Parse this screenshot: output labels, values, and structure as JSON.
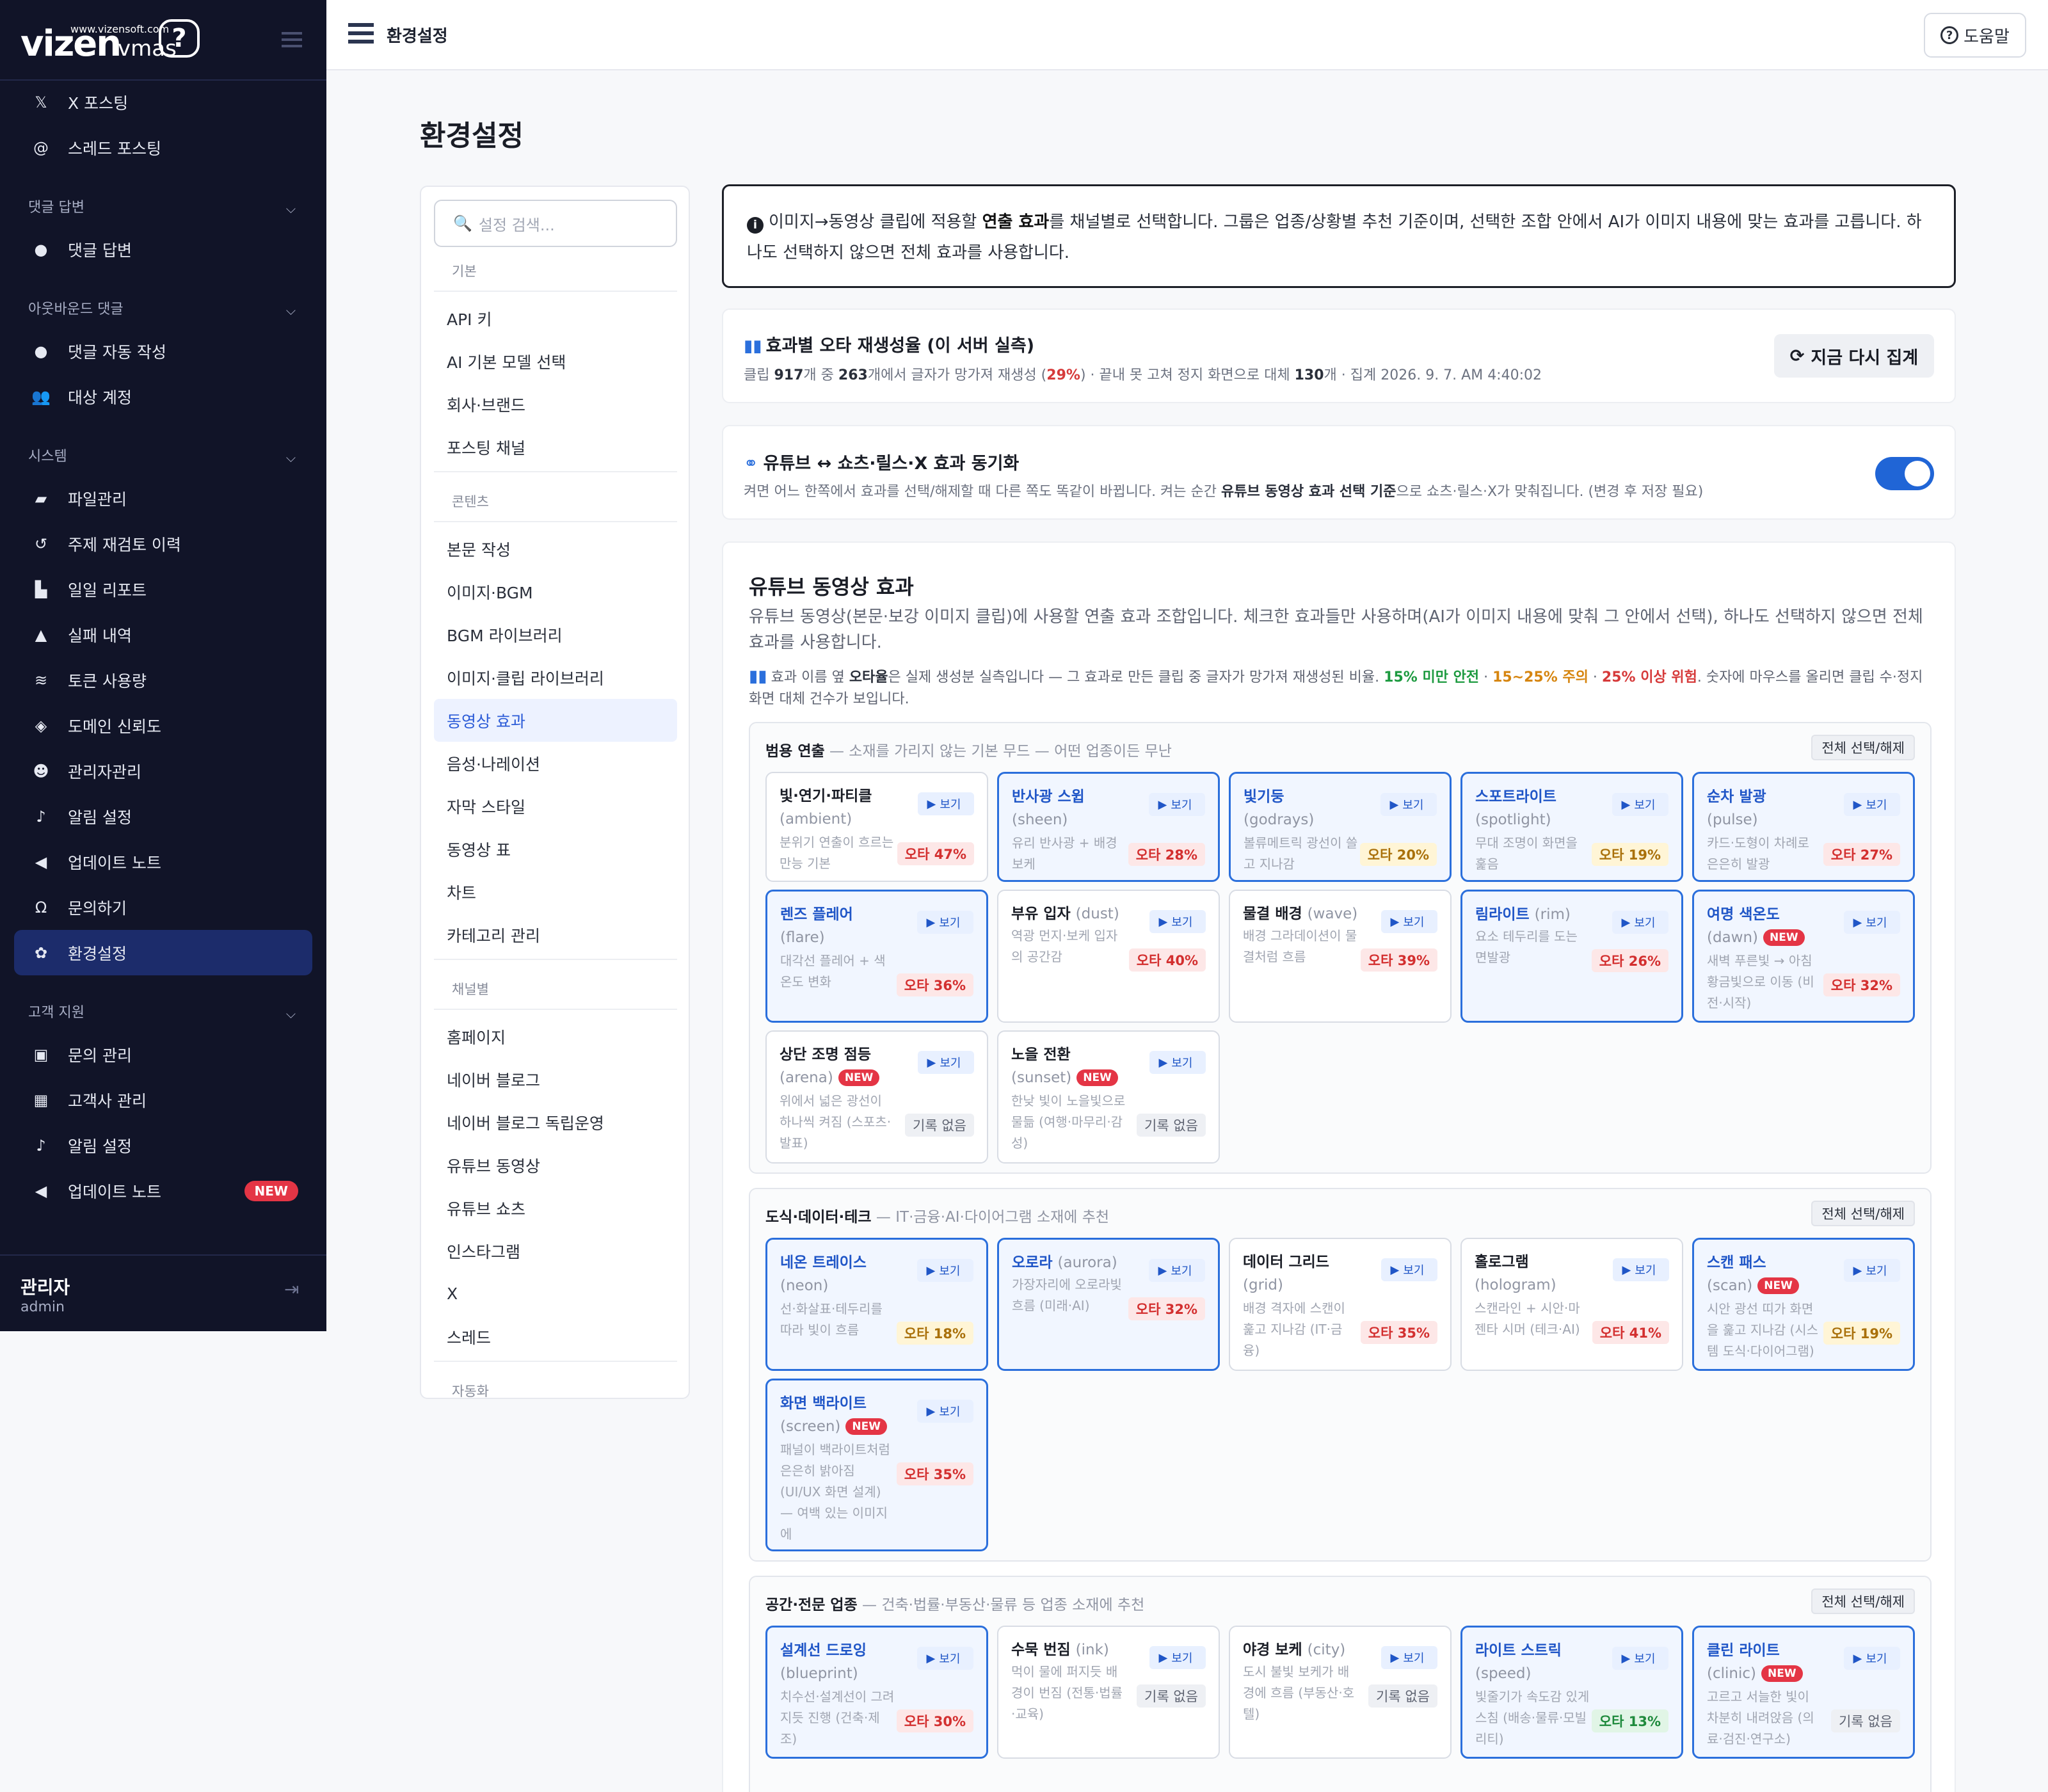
{
  "brand": {
    "logo": "vizen",
    "logo_sub": "vmas",
    "url": "www.vizensoft.com",
    "help_glyph": "?"
  },
  "sidebar": {
    "items_top": [
      {
        "label": "X 포스팅",
        "icon": "x-icon"
      },
      {
        "label": "스레드 포스팅",
        "icon": "at-icon"
      }
    ],
    "sec_comment": "댓글 답변",
    "comment_items": [
      {
        "label": "댓글 답변",
        "icon": "comment-icon"
      }
    ],
    "sec_outbound": "아웃바운드 댓글",
    "outbound_items": [
      {
        "label": "댓글 자동 작성",
        "icon": "comment-icon"
      },
      {
        "label": "대상 계정",
        "icon": "users-icon"
      }
    ],
    "sec_system": "시스템",
    "system_items": [
      {
        "label": "파일관리",
        "icon": "folder-icon"
      },
      {
        "label": "주제 재검토 이력",
        "icon": "history-icon"
      },
      {
        "label": "일일 리포트",
        "icon": "chart-icon"
      },
      {
        "label": "실패 내역",
        "icon": "warning-icon"
      },
      {
        "label": "토큰 사용량",
        "icon": "coins-icon"
      },
      {
        "label": "도메인 신뢰도",
        "icon": "shield-icon"
      },
      {
        "label": "관리자관리",
        "icon": "user-gear-icon"
      },
      {
        "label": "알림 설정",
        "icon": "bell-icon"
      },
      {
        "label": "업데이트 노트",
        "icon": "megaphone-icon"
      },
      {
        "label": "문의하기",
        "icon": "headset-icon"
      },
      {
        "label": "환경설정",
        "icon": "gear-icon"
      }
    ],
    "sec_support": "고객 지원",
    "support_items": [
      {
        "label": "문의 관리",
        "icon": "inbox-icon"
      },
      {
        "label": "고객사 관리",
        "icon": "building-icon"
      },
      {
        "label": "알림 설정",
        "icon": "bell-icon"
      },
      {
        "label": "업데이트 노트",
        "icon": "megaphone-icon",
        "badge": "NEW"
      }
    ],
    "user_name": "관리자",
    "user_role": "admin"
  },
  "topbar": {
    "title": "환경설정",
    "help": "도움말"
  },
  "page_title": "환경설정",
  "settings_nav": {
    "search_placeholder": "설정 검색...",
    "groups": [
      {
        "title": "기본",
        "items": [
          "API 키",
          "AI 기본 모델 선택",
          "회사·브랜드",
          "포스팅 채널"
        ]
      },
      {
        "title": "콘텐츠",
        "items": [
          "본문 작성",
          "이미지·BGM",
          "BGM 라이브러리",
          "이미지·클립 라이브러리",
          "동영상 효과",
          "음성·나레이션",
          "자막 스타일",
          "동영상 표",
          "차트",
          "카테고리 관리"
        ]
      },
      {
        "title": "채널별",
        "items": [
          "홈페이지",
          "네이버 블로그",
          "네이버 블로그 독립운영",
          "유튜브 동영상",
          "유튜브 쇼츠",
          "인스타그램",
          "X",
          "스레드"
        ]
      },
      {
        "title": "자동화",
        "items": []
      }
    ],
    "active": "동영상 효과"
  },
  "info": {
    "p1": "이미지→동영상 클립에 적용할 ",
    "b1": "연출 효과",
    "p2": "를 채널별로 선택합니다. 그룹은 업종/상황별 추천 기준이며, 선택한 조합 안에서 AI가 이미지 내용에 맞는 효과를 고릅니다. 하나도 선택하지 않으면 전체 효과를 사용합니다."
  },
  "stats": {
    "title": "효과별 오타 재생성율 (이 서버 실측)",
    "s1": "클립 ",
    "total": "917",
    "s2": "개 중 ",
    "bad": "263",
    "s3": "개에서 글자가 망가져 재생성 (",
    "pct": "29%",
    "s4": ") · 끝내 못 고쳐 정지 화면으로 대체 ",
    "still": "130",
    "s5": "개 · 집계 2026. 9. 7. AM 4:40:02",
    "refresh": "지금 다시 집계"
  },
  "sync": {
    "title": "유튜브 ↔ 쇼츠·릴스·X 효과 동기화",
    "p1": "켜면 어느 한쪽에서 효과를 선택/해제할 때 다른 쪽도 똑같이 바뀝니다. 켜는 순간 ",
    "b1": "유튜브 동영상 효과 선택 기준",
    "p2": "으로 쇼츠·릴스·X가 맞춰집니다. (변경 후 저장 필요)",
    "enabled": true
  },
  "yt": {
    "title": "유튜브 동영상 효과",
    "desc": "유튜브 동영상(본문·보강 이미지 클립)에 사용할 연출 효과 조합입니다. 체크한 효과들만 사용하며(AI가 이미지 내용에 맞춰 그 안에서 선택), 하나도 선택하지 않으면 전체 효과를 사용합니다.",
    "legend": {
      "p1": "효과 이름 옆 ",
      "b1": "오타율",
      "p2": "은 실제 생성분 실측입니다 — 그 효과로 만든 클립 중 글자가 망가져 재생성된 비율. ",
      "g": "15% 미만 안전",
      "dot1": " · ",
      "o": "15~25% 주의",
      "dot2": " · ",
      "r": "25% 이상 위험",
      "p3": ". 숫자에 마우스를 올리면 클립 수·정지 화면 대체 건수가 보입니다."
    },
    "preview": "보기",
    "select_all": "전체 선택/해제",
    "groups": [
      {
        "name": "범용 연출",
        "sub": " — 소재를 가리지 않는 기본 무드 — 어떤 업종이든 무난",
        "tiles": [
          {
            "name": "빛·연기·파티클",
            "en": "(ambient)",
            "desc": "분위기 연출이 흐르는 만능 기본",
            "rate": "오타 47%",
            "level": "red",
            "sel": false
          },
          {
            "name": "반사광 스윕",
            "en": "(sheen)",
            "desc": "유리 반사광 + 배경 보케",
            "rate": "오타 28%",
            "level": "red",
            "sel": true
          },
          {
            "name": "빛기둥",
            "en": "(godrays)",
            "desc": "볼류메트릭 광선이 쓸고 지나감",
            "rate": "오타 20%",
            "level": "yel",
            "sel": true
          },
          {
            "name": "스포트라이트",
            "en": "(spotlight)",
            "desc": "무대 조명이 화면을 훑음",
            "rate": "오타 19%",
            "level": "yel",
            "sel": true
          },
          {
            "name": "순차 발광",
            "en": "(pulse)",
            "desc": "카드·도형이 차례로 은은히 발광",
            "rate": "오타 27%",
            "level": "red",
            "sel": true
          },
          {
            "name": "렌즈 플레어",
            "en": "(flare)",
            "desc": "대각선 플레어 + 색온도 변화",
            "rate": "오타 36%",
            "level": "red",
            "sel": true
          },
          {
            "name": "부유 입자",
            "en": "(dust)",
            "desc": "역광 먼지·보케 입자의 공간감",
            "rate": "오타 40%",
            "level": "red",
            "sel": false
          },
          {
            "name": "물결 배경",
            "en": "(wave)",
            "desc": "배경 그라데이션이 물결처럼 흐름",
            "rate": "오타 39%",
            "level": "red",
            "sel": false
          },
          {
            "name": "림라이트",
            "en": "(rim)",
            "desc": "요소 테두리를 도는 면발광",
            "rate": "오타 26%",
            "level": "red",
            "sel": true
          },
          {
            "name": "여명 색온도",
            "en": "(dawn)",
            "desc": "새벽 푸른빛 → 아침 황금빛으로 이동 (비전·시작)",
            "rate": "오타 32%",
            "level": "red",
            "sel": true,
            "new": true
          },
          {
            "name": "상단 조명 점등",
            "en": "(arena)",
            "desc": "위에서 넓은 광선이 하나씩 켜짐 (스포츠·발표)",
            "rate": "기록 없음",
            "level": "none",
            "sel": false,
            "new": true
          },
          {
            "name": "노을 전환",
            "en": "(sunset)",
            "desc": "한낮 빛이 노을빛으로 물듦 (여행·마무리·감성)",
            "rate": "기록 없음",
            "level": "none",
            "sel": false,
            "new": true
          }
        ]
      },
      {
        "name": "도식·데이터·테크",
        "sub": " — IT·금융·AI·다이어그램 소재에 추천",
        "tiles": [
          {
            "name": "네온 트레이스",
            "en": "(neon)",
            "desc": "선·화살표·테두리를 따라 빛이 흐름",
            "rate": "오타 18%",
            "level": "yel",
            "sel": true
          },
          {
            "name": "오로라",
            "en": "(aurora)",
            "desc": "가장자리에 오로라빛 흐름 (미래·AI)",
            "rate": "오타 32%",
            "level": "red",
            "sel": true
          },
          {
            "name": "데이터 그리드",
            "en": "(grid)",
            "desc": "배경 격자에 스캔이 훑고 지나감 (IT·금융)",
            "rate": "오타 35%",
            "level": "red",
            "sel": false
          },
          {
            "name": "홀로그램",
            "en": "(hologram)",
            "desc": "스캔라인 + 시안·마젠타 시머 (테크·AI)",
            "rate": "오타 41%",
            "level": "red",
            "sel": false
          },
          {
            "name": "스캔 패스",
            "en": "(scan)",
            "desc": "시안 광선 띠가 화면을 훑고 지나감 (시스템 도식·다이어그램)",
            "rate": "오타 19%",
            "level": "yel",
            "sel": true,
            "new": true
          },
          {
            "name": "화면 백라이트",
            "en": "(screen)",
            "desc": "패널이 백라이트처럼 은은히 밝아짐 (UI/UX 화면 설계) — 여백 있는 이미지에",
            "rate": "오타 35%",
            "level": "red",
            "sel": true,
            "new": true
          }
        ]
      },
      {
        "name": "공간·전문 업종",
        "sub": " — 건축·법률·부동산·물류 등 업종 소재에 추천",
        "tiles": [
          {
            "name": "설계선 드로잉",
            "en": "(blueprint)",
            "desc": "치수선·설계선이 그려지듯 진행 (건축·제조)",
            "rate": "오타 30%",
            "level": "red",
            "sel": true
          },
          {
            "name": "수묵 번짐",
            "en": "(ink)",
            "desc": "먹이 물에 퍼지듯 배경이 번짐 (전통·법률·교육)",
            "rate": "기록 없음",
            "level": "none",
            "sel": false
          },
          {
            "name": "야경 보케",
            "en": "(city)",
            "desc": "도시 불빛 보케가 배경에 흐름 (부동산·호텔)",
            "rate": "기록 없음",
            "level": "none",
            "sel": false
          },
          {
            "name": "라이트 스트릭",
            "en": "(speed)",
            "desc": "빛줄기가 속도감 있게 스침 (배송·물류·모빌리티)",
            "rate": "오타 13%",
            "level": "grn",
            "sel": true
          },
          {
            "name": "클린 라이트",
            "en": "(clinic)",
            "desc": "고르고 서늘한 빛이 차분히 내려앉음 (의료·검진·연구소)",
            "rate": "기록 없음",
            "level": "none",
            "sel": true,
            "new": true
          }
        ]
      }
    ]
  },
  "colors": {
    "sidebar_bg": "#111428",
    "accent": "#2b6fdc",
    "danger": "#d32f2f",
    "warn": "#a9700a",
    "safe": "#1e8a3c"
  }
}
